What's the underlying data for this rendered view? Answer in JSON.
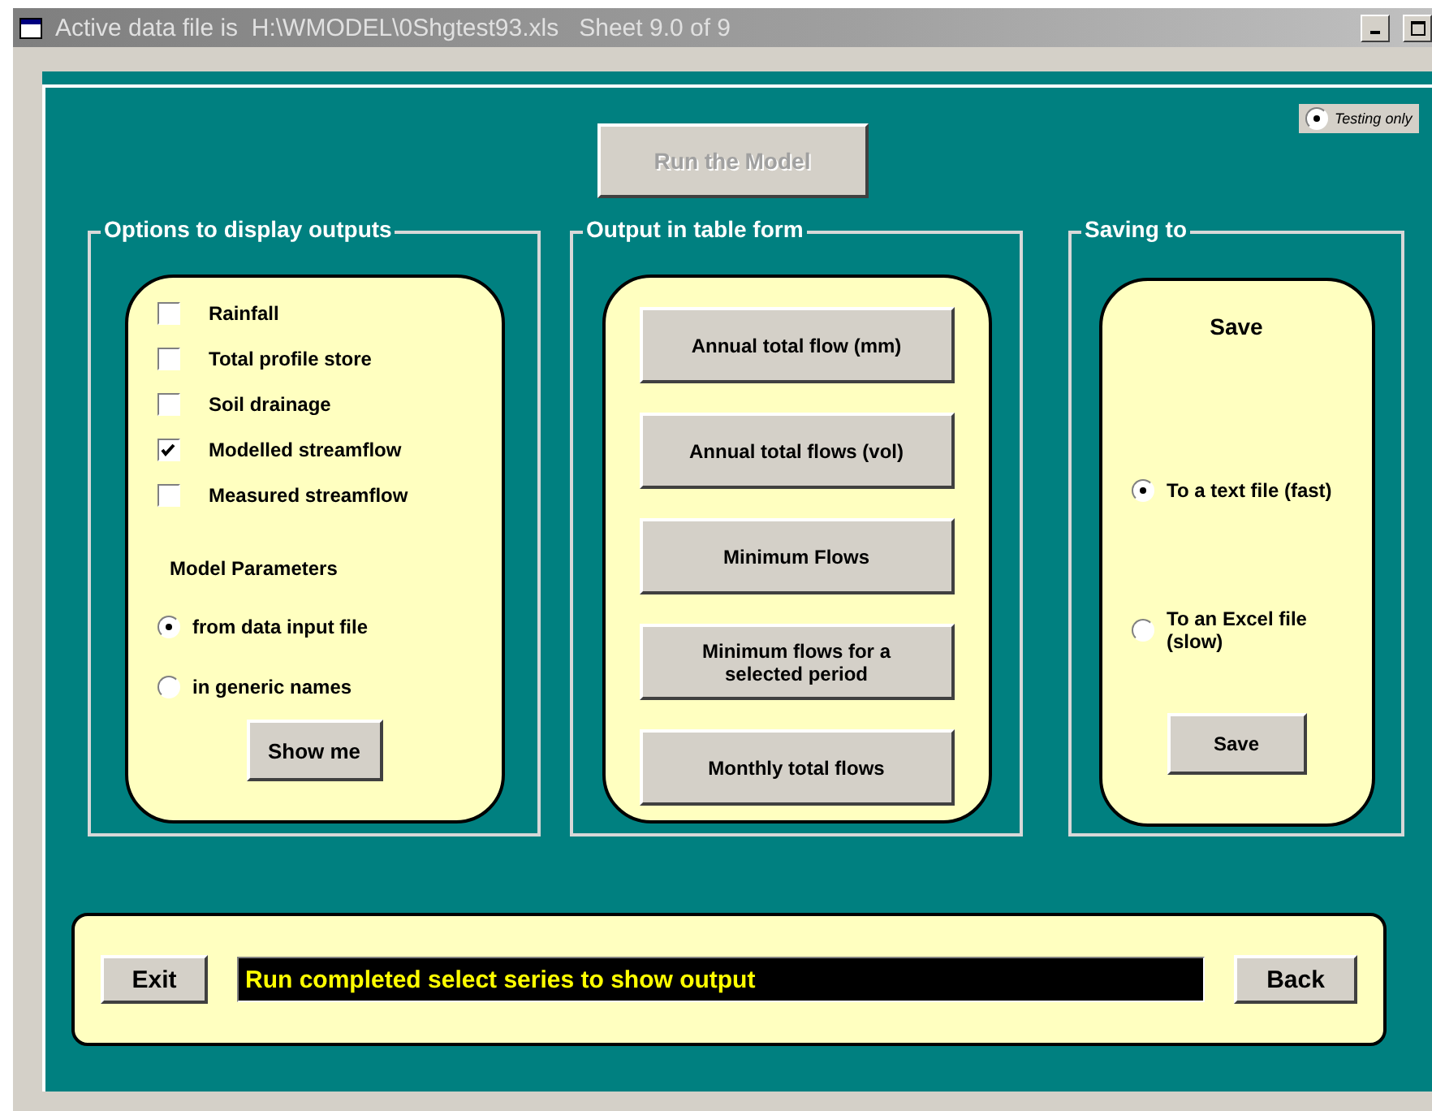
{
  "window": {
    "title": "Active data file is  H:\\WMODEL\\0Shgtest93.xls   Sheet 9.0 of 9"
  },
  "testing_option": {
    "label": "Testing only",
    "selected": true
  },
  "run_button": {
    "label": "Run the Model",
    "disabled": true
  },
  "display_options": {
    "title": "Options to display outputs",
    "series": [
      {
        "label": "Rainfall",
        "checked": false
      },
      {
        "label": "Total profile store",
        "checked": false
      },
      {
        "label": "Soil drainage",
        "checked": false
      },
      {
        "label": "Modelled streamflow",
        "checked": true
      },
      {
        "label": "Measured streamflow",
        "checked": false
      }
    ],
    "parameters_title": "Model Parameters",
    "parameters": [
      {
        "label": "from data input file",
        "selected": true
      },
      {
        "label": "in generic names",
        "selected": false
      }
    ],
    "show_button": {
      "label": "Show me"
    }
  },
  "table_output": {
    "title": "Output in table form",
    "buttons": [
      "Annual total flow (mm)",
      "Annual total flows (vol)",
      "Minimum Flows",
      "Minimum flows for a selected period",
      "Monthly total flows"
    ]
  },
  "saving": {
    "title": "Saving to",
    "heading": "Save",
    "options": [
      {
        "label": "To a text file (fast)",
        "selected": true
      },
      {
        "label": "To an Excel file (slow)",
        "selected": false
      }
    ],
    "save_button": {
      "label": "Save"
    }
  },
  "bottom": {
    "exit": {
      "label": "Exit"
    },
    "status": "Run completed select series to show output",
    "back": {
      "label": "Back"
    }
  }
}
